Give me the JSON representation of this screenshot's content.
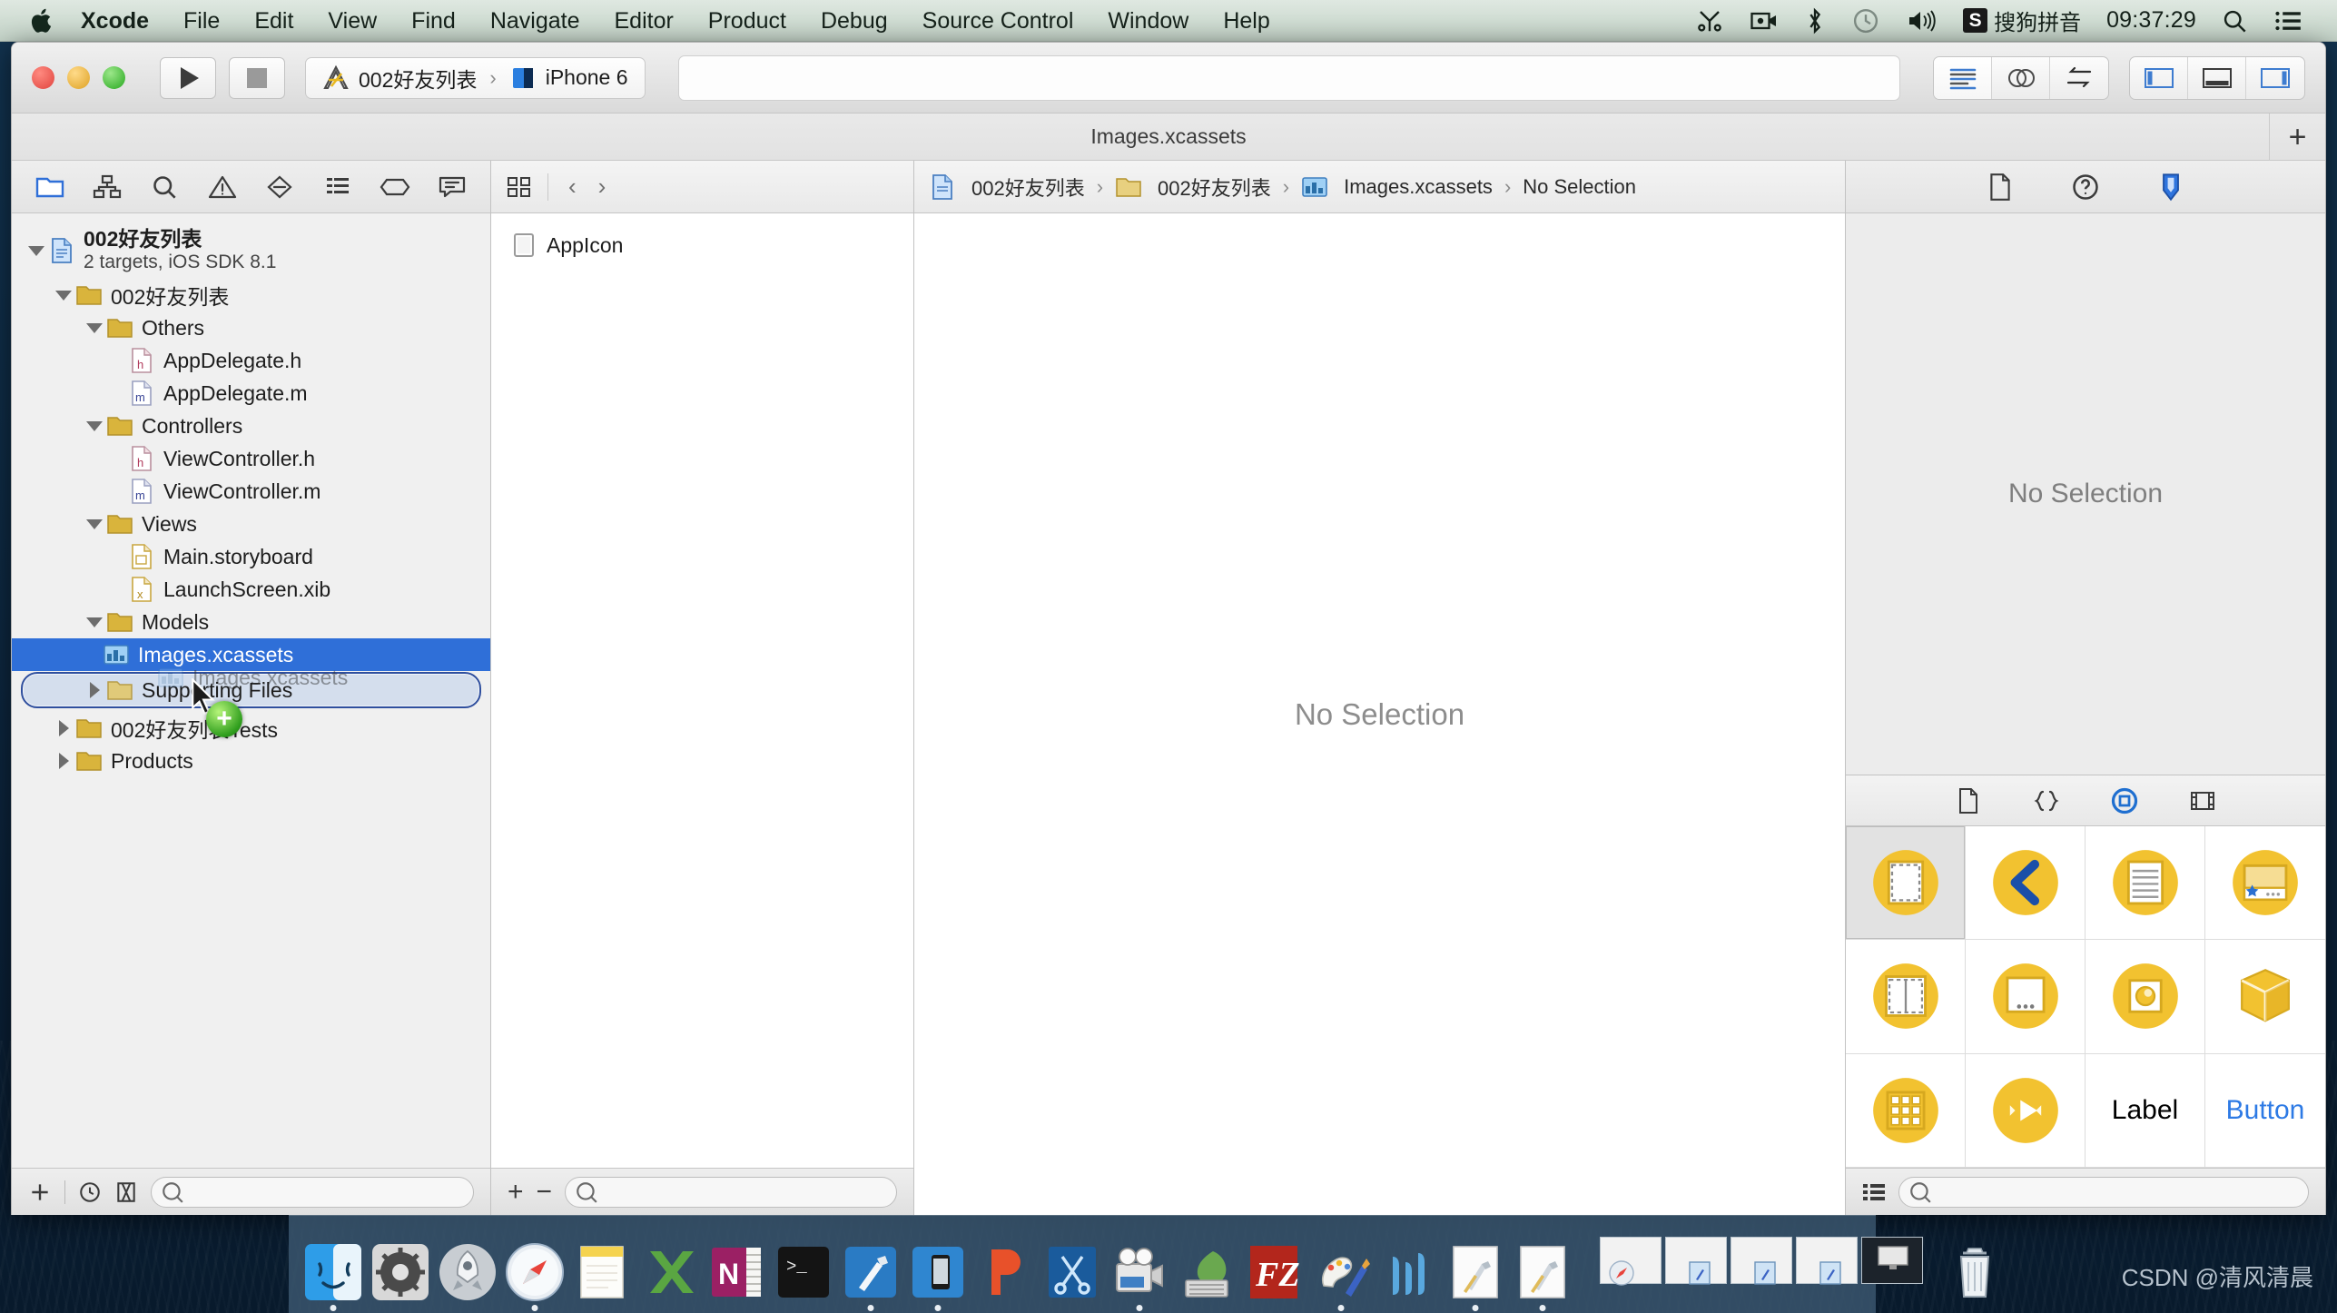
{
  "menubar": {
    "apple_icon": "apple-icon",
    "items": [
      {
        "label": "Xcode",
        "bold": true
      },
      {
        "label": "File",
        "bold": false
      },
      {
        "label": "Edit",
        "bold": false
      },
      {
        "label": "View",
        "bold": false
      },
      {
        "label": "Find",
        "bold": false
      },
      {
        "label": "Navigate",
        "bold": false
      },
      {
        "label": "Editor",
        "bold": false
      },
      {
        "label": "Product",
        "bold": false
      },
      {
        "label": "Debug",
        "bold": false
      },
      {
        "label": "Source Control",
        "bold": false
      },
      {
        "label": "Window",
        "bold": false
      },
      {
        "label": "Help",
        "bold": false
      }
    ],
    "status": {
      "icons": [
        "scissors-icon",
        "screen-record-icon",
        "bluetooth-icon",
        "clock-icon",
        "volume-icon"
      ],
      "input_method_badge": "S",
      "input_method_label": "搜狗拼音",
      "time": "09:37:29",
      "search_icon": "search-icon",
      "notification_center_icon": "list-icon"
    }
  },
  "toolbar": {
    "run_label": "run-button",
    "stop_label": "stop-button",
    "scheme": {
      "project": "002好友列表",
      "separator": "›",
      "destination": "iPhone 6"
    },
    "activity_placeholder": "",
    "editor_segments": [
      "standard-editor",
      "assistant-editor",
      "version-editor"
    ],
    "view_segments": [
      "navigator-toggle",
      "debug-area-toggle",
      "utilities-toggle"
    ]
  },
  "window": {
    "title": "Images.xcassets",
    "add_tab_label": "+"
  },
  "navigator": {
    "tabs": [
      {
        "name": "project-navigator",
        "selected": true
      },
      {
        "name": "symbol-navigator",
        "selected": false
      },
      {
        "name": "find-navigator",
        "selected": false
      },
      {
        "name": "issue-navigator",
        "selected": false
      },
      {
        "name": "test-navigator",
        "selected": false
      },
      {
        "name": "debug-navigator",
        "selected": false
      },
      {
        "name": "breakpoint-navigator",
        "selected": false
      },
      {
        "name": "report-navigator",
        "selected": false
      }
    ],
    "project": {
      "name": "002好友列表",
      "subtitle": "2 targets, iOS SDK 8.1"
    },
    "tree": [
      {
        "label": "002好友列表",
        "indent": 1,
        "icon": "folder",
        "twist": "down"
      },
      {
        "label": "Others",
        "indent": 2,
        "icon": "folder",
        "twist": "down"
      },
      {
        "label": "AppDelegate.h",
        "indent": 3,
        "icon": "header",
        "twist": "none"
      },
      {
        "label": "AppDelegate.m",
        "indent": 3,
        "icon": "source",
        "twist": "none"
      },
      {
        "label": "Controllers",
        "indent": 2,
        "icon": "folder",
        "twist": "down"
      },
      {
        "label": "ViewController.h",
        "indent": 3,
        "icon": "header",
        "twist": "none"
      },
      {
        "label": "ViewController.m",
        "indent": 3,
        "icon": "source",
        "twist": "none"
      },
      {
        "label": "Views",
        "indent": 2,
        "icon": "folder",
        "twist": "down"
      },
      {
        "label": "Main.storyboard",
        "indent": 3,
        "icon": "storyboard",
        "twist": "none"
      },
      {
        "label": "LaunchScreen.xib",
        "indent": 3,
        "icon": "xib",
        "twist": "none"
      },
      {
        "label": "Models",
        "indent": 2,
        "icon": "folder",
        "twist": "down"
      },
      {
        "label": "Images.xcassets",
        "indent": 3,
        "icon": "xcassets",
        "twist": "none",
        "selected": true
      },
      {
        "label": "Supporting Files",
        "indent": 2,
        "icon": "folder",
        "twist": "right",
        "drop_target": true
      },
      {
        "label": "002好友列表Tests",
        "indent": 1,
        "icon": "folder",
        "twist": "right"
      },
      {
        "label": "Products",
        "indent": 1,
        "icon": "folder",
        "twist": "right"
      }
    ],
    "drag": {
      "ghost_label": "Images.xcassets",
      "badge": "+"
    },
    "bottom": {
      "add_icon": "plus-icon",
      "recent_icon": "clock-icon",
      "filter_icon": "filter-icon",
      "filter_placeholder": ""
    }
  },
  "asset_catalog": {
    "jumpbar": {
      "related_icon": "related-files-icon",
      "back_icon": "back-chevron-icon",
      "forward_icon": "forward-chevron-icon"
    },
    "items": [
      {
        "label": "AppIcon",
        "icon": "appicon-set-icon"
      }
    ],
    "bottom": {
      "add_label": "+",
      "remove_label": "−",
      "filter_placeholder": ""
    }
  },
  "editor": {
    "breadcrumb": [
      {
        "label": "002好友列表",
        "icon": "project-icon"
      },
      {
        "label": "002好友列表",
        "icon": "folder-icon"
      },
      {
        "label": "Images.xcassets",
        "icon": "xcassets-icon"
      },
      {
        "label": "No Selection",
        "icon": ""
      }
    ],
    "separator": "›",
    "empty_state": "No Selection"
  },
  "utilities": {
    "inspector_tabs": [
      {
        "name": "file-inspector",
        "selected": false
      },
      {
        "name": "quick-help-inspector",
        "selected": false
      },
      {
        "name": "identity-inspector",
        "selected": true
      }
    ],
    "inspector_empty": "No Selection",
    "library_tabs": [
      {
        "name": "file-template-library",
        "selected": false
      },
      {
        "name": "code-snippet-library",
        "selected": false
      },
      {
        "name": "object-library",
        "selected": true
      },
      {
        "name": "media-library",
        "selected": false
      }
    ],
    "library_items": [
      {
        "name": "view-controller",
        "kind": "icon",
        "selected": true
      },
      {
        "name": "navigation-controller",
        "kind": "icon",
        "selected": false
      },
      {
        "name": "table-view-controller",
        "kind": "icon",
        "selected": false
      },
      {
        "name": "tab-bar-controller",
        "kind": "icon",
        "selected": false
      },
      {
        "name": "split-view-controller",
        "kind": "icon",
        "selected": false
      },
      {
        "name": "page-view-controller",
        "kind": "icon",
        "selected": false
      },
      {
        "name": "glkit-view-controller",
        "kind": "icon",
        "selected": false
      },
      {
        "name": "scene-kit-view-controller",
        "kind": "icon",
        "selected": false
      },
      {
        "name": "collection-view-controller",
        "kind": "icon",
        "selected": false
      },
      {
        "name": "avkit-player-view-controller",
        "kind": "icon",
        "selected": false
      },
      {
        "name": "label",
        "kind": "text",
        "text": "Label",
        "selected": false
      },
      {
        "name": "button",
        "kind": "text",
        "text": "Button",
        "selected": false
      }
    ],
    "bottom": {
      "view_mode_icon": "list-view-icon",
      "filter_placeholder": ""
    }
  },
  "dock": {
    "apps": [
      {
        "name": "finder",
        "running": true
      },
      {
        "name": "system-preferences",
        "running": false
      },
      {
        "name": "launchpad",
        "running": false
      },
      {
        "name": "safari",
        "running": true
      },
      {
        "name": "notes",
        "running": false
      },
      {
        "name": "excel",
        "running": false
      },
      {
        "name": "onenote",
        "running": false
      },
      {
        "name": "terminal",
        "running": false
      },
      {
        "name": "xcode",
        "running": true
      },
      {
        "name": "ios-simulator",
        "running": true
      },
      {
        "name": "pdf-reader",
        "running": false
      },
      {
        "name": "snipping-tool",
        "running": false
      },
      {
        "name": "video-editor",
        "running": true
      },
      {
        "name": "evernote",
        "running": false
      },
      {
        "name": "filezilla",
        "running": false
      },
      {
        "name": "paint-app",
        "running": true
      },
      {
        "name": "waveform-app",
        "running": false
      },
      {
        "name": "xcode-beta-1",
        "running": true
      },
      {
        "name": "xcode-beta-2",
        "running": true
      }
    ],
    "minimized_windows": 5,
    "trash": "trash-icon"
  },
  "watermark": "CSDN @清风清晨"
}
